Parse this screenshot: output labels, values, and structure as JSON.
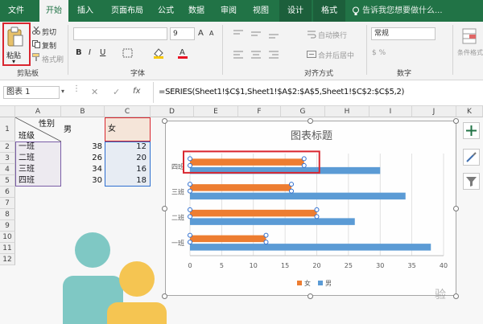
{
  "ribbon_tabs": [
    "文件",
    "开始",
    "插入",
    "页面布局",
    "公式",
    "数据",
    "审阅",
    "视图",
    "设计",
    "格式"
  ],
  "tell_me": "告诉我您想要做什么...",
  "clipboard": {
    "paste": "粘贴",
    "cut": "剪切",
    "copy": "复制",
    "format_painter": "格式刷",
    "group": "剪贴板"
  },
  "font_group": {
    "label": "字体",
    "size": "9"
  },
  "alignment_group": {
    "label": "对齐方式",
    "wrap": "自动换行",
    "merge": "合并后居中"
  },
  "number_group": {
    "label": "数字",
    "format": "常规"
  },
  "styles_group": {
    "conditional": "条件格式"
  },
  "name_box": "图表 1",
  "fx": "fx",
  "formula": "=SERIES(Sheet1!$C$1,Sheet1!$A$2:$A$5,Sheet1!$C$2:$C$5,2)",
  "columns": [
    "A",
    "B",
    "C",
    "D",
    "E",
    "F",
    "G",
    "H",
    "I",
    "J",
    "K"
  ],
  "rows": [
    "1",
    "2",
    "3",
    "4",
    "5",
    "6",
    "7",
    "8",
    "9",
    "10",
    "11",
    "12"
  ],
  "sheet": {
    "header_b": "男",
    "header_c": "女",
    "diag_top": "性别",
    "diag_bottom": "班级",
    "classes": [
      "一班",
      "二班",
      "三班",
      "四班"
    ],
    "male": [
      "38",
      "26",
      "34",
      "30"
    ],
    "female": [
      "12",
      "20",
      "16",
      "18"
    ]
  },
  "colors": {
    "excel_green": "#217346",
    "male_bar": "#5b9bd5",
    "female_bar": "#ed7d31",
    "highlight": "#d9262f"
  },
  "watermark_text": "验",
  "chart_data": {
    "type": "bar",
    "orientation": "horizontal",
    "title": "图表标题",
    "categories": [
      "一班",
      "二班",
      "三班",
      "四班"
    ],
    "series": [
      {
        "name": "男",
        "values": [
          38,
          26,
          34,
          30
        ],
        "color": "#5b9bd5"
      },
      {
        "name": "女",
        "values": [
          12,
          20,
          16,
          18
        ],
        "color": "#ed7d31"
      }
    ],
    "xlim": [
      0,
      40
    ],
    "x_ticks": [
      "0",
      "5",
      "10",
      "15",
      "20",
      "25",
      "30",
      "35",
      "40"
    ],
    "legend": "bottom",
    "grid": true,
    "selected_series": "女"
  }
}
